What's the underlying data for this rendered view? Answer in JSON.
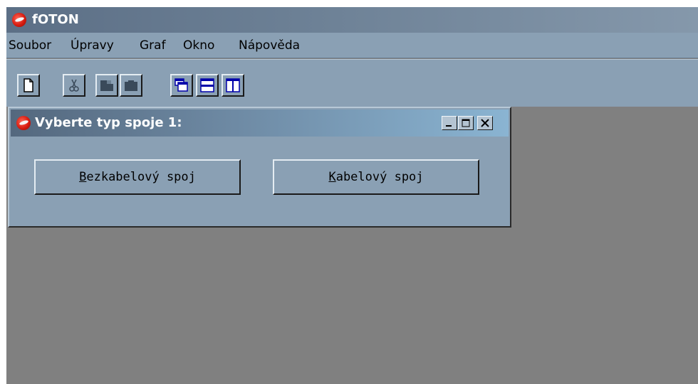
{
  "app": {
    "title": "fOTON"
  },
  "menu": [
    {
      "label": "Soubor"
    },
    {
      "label": "Úpravy"
    },
    {
      "label": "Graf"
    },
    {
      "label": "Okno"
    },
    {
      "label": "Nápověda"
    }
  ],
  "toolbar": {
    "buttons": [
      {
        "icon": "new-document-icon",
        "enabled": true
      },
      {
        "icon": "cut-icon",
        "enabled": false
      },
      {
        "icon": "copy-icon",
        "enabled": false
      },
      {
        "icon": "paste-icon",
        "enabled": false
      },
      {
        "icon": "cascade-windows-icon",
        "enabled": true
      },
      {
        "icon": "tile-horizontal-icon",
        "enabled": true
      },
      {
        "icon": "tile-vertical-icon",
        "enabled": true
      }
    ]
  },
  "dialog": {
    "title": "Vyberte typ spoje 1:",
    "buttons": [
      {
        "mnemonic": "B",
        "rest": "ezkabelový spoj"
      },
      {
        "mnemonic": "K",
        "rest": "abelový spoj"
      }
    ]
  },
  "colors": {
    "workspace": "#808080",
    "chrome": "#8aa0b4",
    "icon_blue": "#0000aa",
    "icon_disabled": "#3a4a5a"
  }
}
